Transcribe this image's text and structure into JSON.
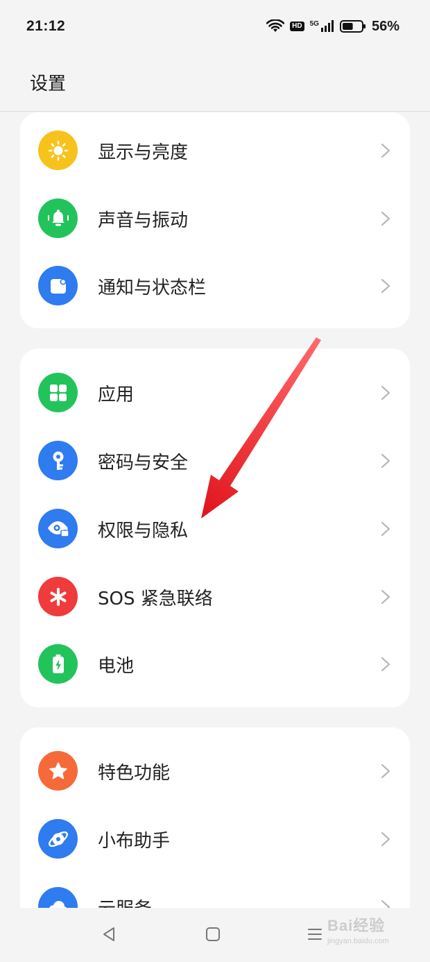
{
  "status_bar": {
    "time": "21:12",
    "hd_label": "HD",
    "network_label": "5G",
    "battery_percent": "56%",
    "battery_level": 0.56
  },
  "header": {
    "title": "设置"
  },
  "groups": [
    {
      "items": [
        {
          "label": "显示与亮度",
          "icon": "sun-icon",
          "color": "#f7c21b"
        },
        {
          "label": "声音与振动",
          "icon": "bell-icon",
          "color": "#23c35b"
        },
        {
          "label": "通知与状态栏",
          "icon": "notification-icon",
          "color": "#2f7bf0"
        }
      ]
    },
    {
      "items": [
        {
          "label": "应用",
          "icon": "apps-grid-icon",
          "color": "#23c35b"
        },
        {
          "label": "密码与安全",
          "icon": "key-icon",
          "color": "#2f7bf0"
        },
        {
          "label": "权限与隐私",
          "icon": "eye-lock-icon",
          "color": "#2f7bf0"
        },
        {
          "label": "SOS 紧急联络",
          "icon": "asterisk-icon",
          "color": "#ef3b3b"
        },
        {
          "label": "电池",
          "icon": "battery-charge-icon",
          "color": "#23c35b"
        }
      ]
    },
    {
      "items": [
        {
          "label": "特色功能",
          "icon": "star-icon",
          "color": "#f66a3a"
        },
        {
          "label": "小布助手",
          "icon": "planet-icon",
          "color": "#2f7bf0"
        },
        {
          "label": "云服务",
          "icon": "cloud-icon",
          "color": "#2f7bf0"
        }
      ]
    }
  ],
  "annotation": {
    "arrow_color": "#e0141b"
  },
  "watermark": {
    "main": "Bai经验",
    "sub": "jingyan.baidu.com"
  }
}
